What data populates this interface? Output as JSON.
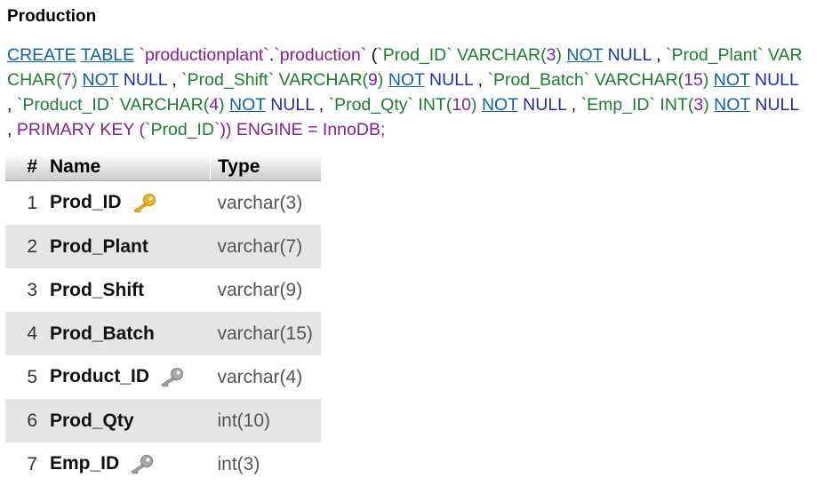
{
  "page": {
    "title": "Production"
  },
  "sql": {
    "create": "CREATE",
    "table": "TABLE",
    "db": "`productionplant`",
    "dot": ".",
    "tbl": "`production`",
    "open": " (",
    "c1": "`Prod_ID`",
    "c1type": " VARCHAR(",
    "c1len": "3",
    "c1close": ") ",
    "not": "NOT",
    "null": " NULL",
    "sep": " , ",
    "c2": "`Prod_Plant`",
    "c2type": " VARCHAR(",
    "c2len": "7",
    "c3": "`Prod_Shift`",
    "c3type": " VARCHAR(",
    "c3len": "9",
    "c4": "`Prod_Batch`",
    "c4type": " VARCHAR(",
    "c4len": "15",
    "c5": "`Product_ID`",
    "c5type": " VARCHAR(",
    "c5len": "4",
    "c6": "`Prod_Qty`",
    "c6type": " INT(",
    "c6len": "10",
    "c7": "`Emp_ID`",
    "c7type": " INT(",
    "c7len": "3",
    "pk": "PRIMARY KEY (",
    "pkcol": "`Prod_ID`",
    "pkclose": ")) ENGINE = InnoDB;"
  },
  "columns_table": {
    "headers": {
      "num": "#",
      "name": "Name",
      "type": "Type"
    },
    "rows": [
      {
        "num": "1",
        "name": "Prod_ID",
        "type": "varchar(3)",
        "key": "primary"
      },
      {
        "num": "2",
        "name": "Prod_Plant",
        "type": "varchar(7)",
        "key": "none"
      },
      {
        "num": "3",
        "name": "Prod_Shift",
        "type": "varchar(9)",
        "key": "none"
      },
      {
        "num": "4",
        "name": "Prod_Batch",
        "type": "varchar(15)",
        "key": "none"
      },
      {
        "num": "5",
        "name": "Product_ID",
        "type": "varchar(4)",
        "key": "index"
      },
      {
        "num": "6",
        "name": "Prod_Qty",
        "type": "int(10)",
        "key": "none"
      },
      {
        "num": "7",
        "name": "Emp_ID",
        "type": "int(3)",
        "key": "index"
      }
    ]
  },
  "icons": {
    "primary": "gold-key-icon",
    "index": "silver-key-icon"
  },
  "colors": {
    "primary_key": "#f2b21b",
    "index_key": "#a9a9a9",
    "row_alt": "#e5e5e5"
  }
}
